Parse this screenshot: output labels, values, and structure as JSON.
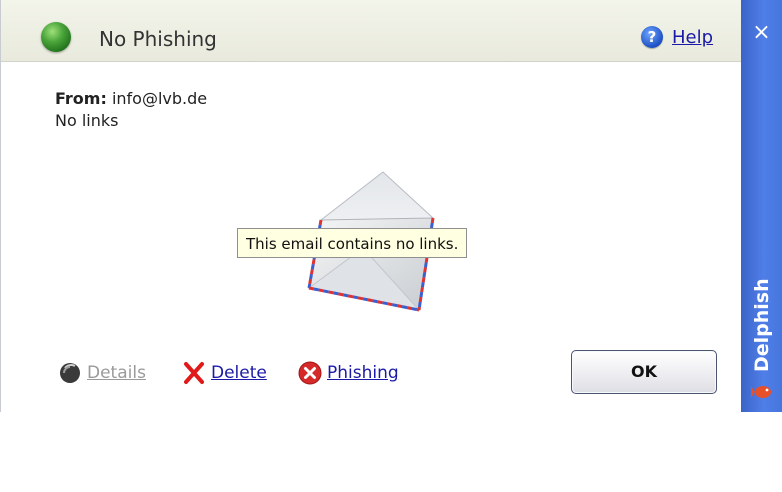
{
  "window": {
    "title": "No Phishing",
    "help_label": "Help"
  },
  "message": {
    "from_label": "From:",
    "from_value": "info@lvb.de",
    "links_status": "No links"
  },
  "tooltip": {
    "text": "This email contains no links."
  },
  "footer": {
    "details_label": "Details",
    "delete_label": "Delete",
    "phishing_label": "Phishing",
    "ok_label": "OK"
  },
  "sidebar": {
    "close_glyph": "×",
    "brand": "Delphish"
  },
  "icons": {
    "title": "green-orb-icon",
    "help": "help-question-icon",
    "details": "details-icon",
    "delete": "red-x-icon",
    "phishing": "red-x-circle-icon",
    "envelope": "open-envelope-icon",
    "brand": "fish-icon"
  },
  "colors": {
    "link": "#1a1aa6",
    "sidebar": "#4f7ee8",
    "tooltip_bg": "#ffffe1",
    "disabled_link": "#9a9a9a"
  }
}
